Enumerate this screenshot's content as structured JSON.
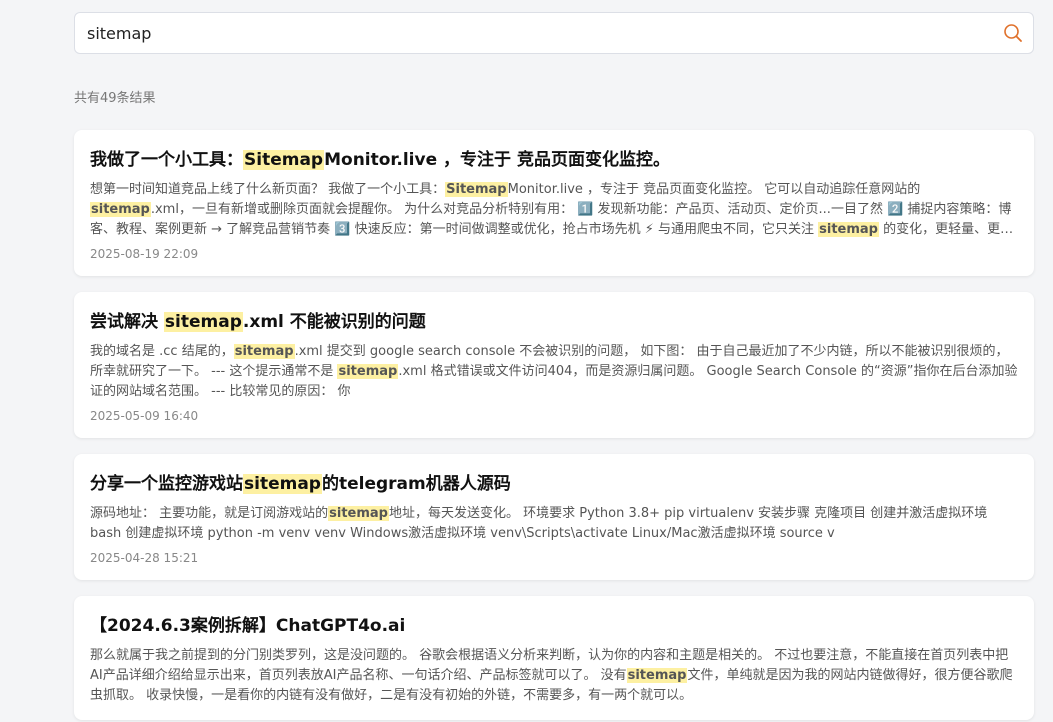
{
  "search": {
    "query": "sitemap",
    "highlight_color": "#fdf0a2",
    "icon": "search-icon",
    "icon_color": "#e0712b"
  },
  "result_count": "共有49条结果",
  "results": [
    {
      "title": [
        {
          "t": "我做了一个小工具：",
          "hl": false
        },
        {
          "t": "Sitemap",
          "hl": true
        },
        {
          "t": "Monitor.live ，专注于 竞品页面变化监控。",
          "hl": false
        }
      ],
      "snippet": [
        {
          "t": "想第一时间知道竞品上线了什么新页面？ 我做了一个小工具：",
          "hl": false
        },
        {
          "t": "Sitemap",
          "hl": true
        },
        {
          "t": "Monitor.live ，专注于 竞品页面变化监控。 它可以自动追踪任意网站的 ",
          "hl": false
        },
        {
          "t": "sitemap",
          "hl": true
        },
        {
          "t": ".xml，一旦有新增或删除页面就会提醒你。 为什么对竞品分析特别有用： 1️⃣ 发现新功能：产品页、活动页、定价页...一目了然 2️⃣ 捕捉内容策略：博客、教程、案例更新 → 了解竞品营销节奏 3️⃣ 快速反应：第一时间做调整或优化，抢占市场先机 ⚡ 与通用爬虫不同，它只关注 ",
          "hl": false
        },
        {
          "t": "sitemap",
          "hl": true
        },
        {
          "t": " 的变化，更轻量、更精准。",
          "hl": false
        }
      ],
      "date": "2025-08-19 22:09"
    },
    {
      "title": [
        {
          "t": "尝试解决 ",
          "hl": false
        },
        {
          "t": "sitemap",
          "hl": true
        },
        {
          "t": ".xml 不能被识别的问题",
          "hl": false
        }
      ],
      "snippet": [
        {
          "t": "我的域名是 .cc 结尾的，",
          "hl": false
        },
        {
          "t": "sitemap",
          "hl": true
        },
        {
          "t": ".xml 提交到 google search console 不会被识别的问题， 如下图： 由于自己最近加了不少内链，所以不能被识别很烦的，所幸就研究了一下。 --- 这个提示通常不是 ",
          "hl": false
        },
        {
          "t": "sitemap",
          "hl": true
        },
        {
          "t": ".xml 格式错误或文件访问404，而是资源归属问题。 Google Search Console 的“资源”指你在后台添加验证的网站域名范围。 --- 比较常见的原因： 你",
          "hl": false
        }
      ],
      "date": "2025-05-09 16:40"
    },
    {
      "title": [
        {
          "t": "分享一个监控游戏站",
          "hl": false
        },
        {
          "t": "sitemap",
          "hl": true
        },
        {
          "t": "的telegram机器人源码",
          "hl": false
        }
      ],
      "snippet": [
        {
          "t": "源码地址： 主要功能，就是订阅游戏站的",
          "hl": false
        },
        {
          "t": "sitemap",
          "hl": true
        },
        {
          "t": "地址，每天发送变化。 环境要求 Python 3.8+ pip virtualenv 安装步骤 克隆项目 创建并激活虚拟环境 bash 创建虚拟环境 python -m venv venv Windows激活虚拟环境 venv\\Scripts\\activate Linux/Mac激活虚拟环境 source v",
          "hl": false
        }
      ],
      "date": "2025-04-28 15:21"
    },
    {
      "title": [
        {
          "t": "【2024.6.3案例拆解】ChatGPT4o.ai",
          "hl": false
        }
      ],
      "snippet": [
        {
          "t": "那么就属于我之前提到的分门别类罗列，这是没问题的。 谷歌会根据语义分析来判断，认为你的内容和主题是相关的。 不过也要注意，不能直接在首页列表中把AI产品详细介绍给显示出来，首页列表放AI产品名称、一句话介绍、产品标签就可以了。 没有",
          "hl": false
        },
        {
          "t": "sitemap",
          "hl": true
        },
        {
          "t": "文件，单纯就是因为我的网站内链做得好，很方便谷歌爬虫抓取。 收录快慢，一是看你的内链有没有做好，二是有没有初始的外链，不需要多，有一两个就可以。",
          "hl": false
        }
      ],
      "date": ""
    }
  ]
}
